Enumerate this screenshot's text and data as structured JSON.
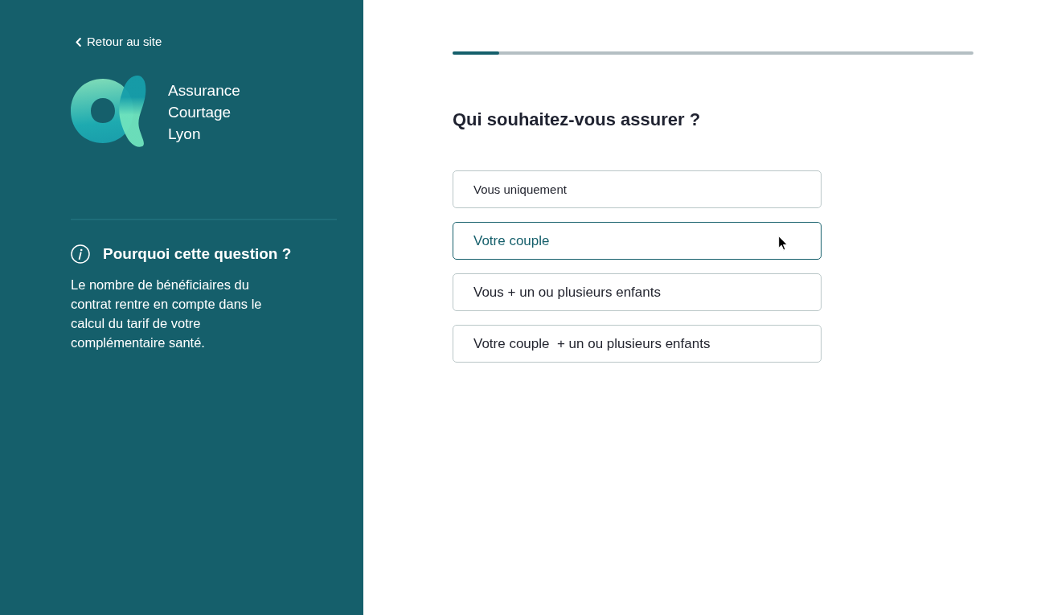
{
  "sidebar": {
    "back_link": {
      "label": "Retour au site"
    },
    "brand": {
      "name": "Assurance Courtage Lyon"
    },
    "help": {
      "title": "Pourquoi cette question ?",
      "text": "Le nombre de bénéficiaires du contrat rentre en compte dans le calcul du tarif de votre complémentaire santé."
    }
  },
  "main": {
    "progress": {
      "level": 0.09
    },
    "question": "Qui souhaitez-vous assurer ?",
    "options": [
      {
        "label": "Vous uniquement",
        "hovered": false
      },
      {
        "label": "Votre couple",
        "hovered": true
      },
      {
        "label": "Vous + un ou plusieurs enfants",
        "hovered": false
      },
      {
        "label": "Votre couple  + un ou plusieurs enfants",
        "hovered": false
      }
    ]
  }
}
